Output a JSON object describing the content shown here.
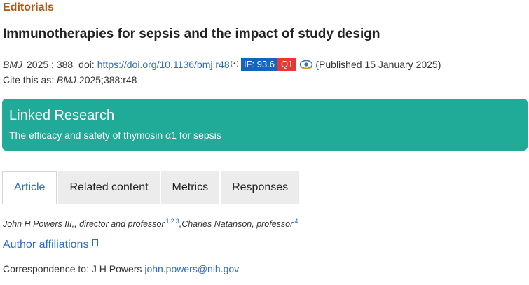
{
  "section_label": "Editorials",
  "title": "Immunotherapies for sepsis and the impact of study design",
  "meta": {
    "journal": "BMJ",
    "year_volume": "2025 ; 388",
    "doi_label": "doi:",
    "doi_url": "https://doi.org/10.1136/bmj.r48",
    "signal_glyph": "(•)",
    "impact_factor": "IF: 93.6",
    "quartile": "Q1",
    "published": "(Published 15 January 2025)"
  },
  "cite": {
    "prefix": "Cite this as:",
    "journal": "BMJ",
    "ref": "2025;388:r48"
  },
  "linked_research": {
    "heading": "Linked Research",
    "item": "The efficacy and safety of thymosin α1 for sepsis"
  },
  "tabs": [
    {
      "label": "Article",
      "active": true
    },
    {
      "label": "Related content",
      "active": false
    },
    {
      "label": "Metrics",
      "active": false
    },
    {
      "label": "Responses",
      "active": false
    }
  ],
  "authors": {
    "author1": "John H Powers III,, director and professor",
    "author1_refs": [
      "1",
      "2",
      "3"
    ],
    "author2": ",Charles Natanson, professor",
    "author2_refs": [
      "4"
    ]
  },
  "affiliations_label": "Author affiliations",
  "correspondence": {
    "prefix": "Correspondence to: J H Powers",
    "email": "john.powers@nih.gov"
  },
  "colors": {
    "section": "#b3560f",
    "link": "#2a6ebb",
    "teal": "#1fab98",
    "if_badge": "#1565c0",
    "q_badge": "#e53935"
  }
}
